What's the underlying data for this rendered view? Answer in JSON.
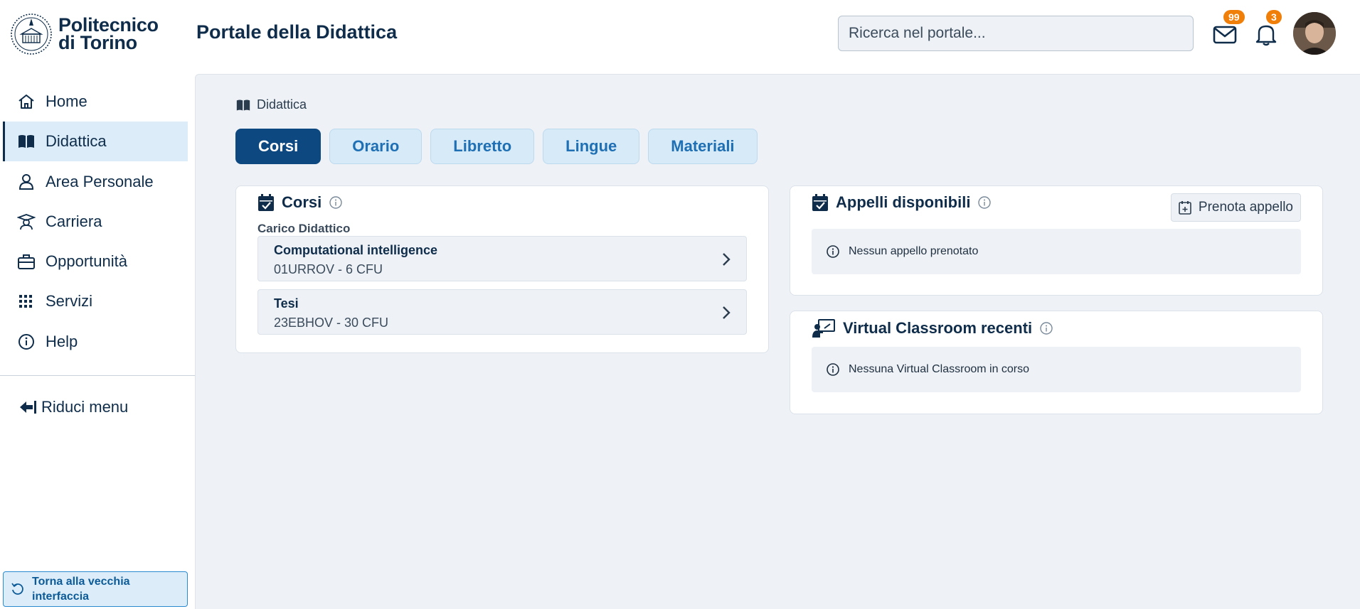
{
  "header": {
    "logo_line1": "Politecnico",
    "logo_line2": "di Torino",
    "portal_title": "Portale della Didattica",
    "search_placeholder": "Ricerca nel portale...",
    "mail_badge": "99",
    "notifications_badge": "3"
  },
  "sidebar": {
    "items": [
      {
        "label": "Home",
        "icon": "home-icon"
      },
      {
        "label": "Didattica",
        "icon": "book-icon",
        "active": true
      },
      {
        "label": "Area Personale",
        "icon": "user-icon"
      },
      {
        "label": "Carriera",
        "icon": "graduate-icon"
      },
      {
        "label": "Opportunità",
        "icon": "briefcase-icon"
      },
      {
        "label": "Servizi",
        "icon": "grid-icon"
      },
      {
        "label": "Help",
        "icon": "info-icon"
      }
    ],
    "reduce_label": "Riduci menu",
    "old_ui_label": "Torna alla vecchia interfaccia"
  },
  "breadcrumb": "Didattica",
  "tabs": [
    {
      "label": "Corsi",
      "active": true
    },
    {
      "label": "Orario"
    },
    {
      "label": "Libretto"
    },
    {
      "label": "Lingue"
    },
    {
      "label": "Materiali"
    }
  ],
  "corsi_card": {
    "title": "Corsi",
    "sub_label": "Carico Didattico",
    "courses": [
      {
        "name": "Computational intelligence",
        "code": "01URROV - 6 CFU"
      },
      {
        "name": "Tesi",
        "code": "23EBHOV - 30 CFU"
      }
    ]
  },
  "appelli_card": {
    "title": "Appelli disponibili",
    "button_label": "Prenota appello",
    "notice": "Nessun appello prenotato"
  },
  "vc_card": {
    "title": "Virtual Classroom recenti",
    "notice": "Nessuna Virtual Classroom in corso"
  },
  "colors": {
    "primary": "#0d4880",
    "accent_light": "#d6eaf8",
    "badge": "#f07f0a",
    "background": "#eef2f6"
  }
}
